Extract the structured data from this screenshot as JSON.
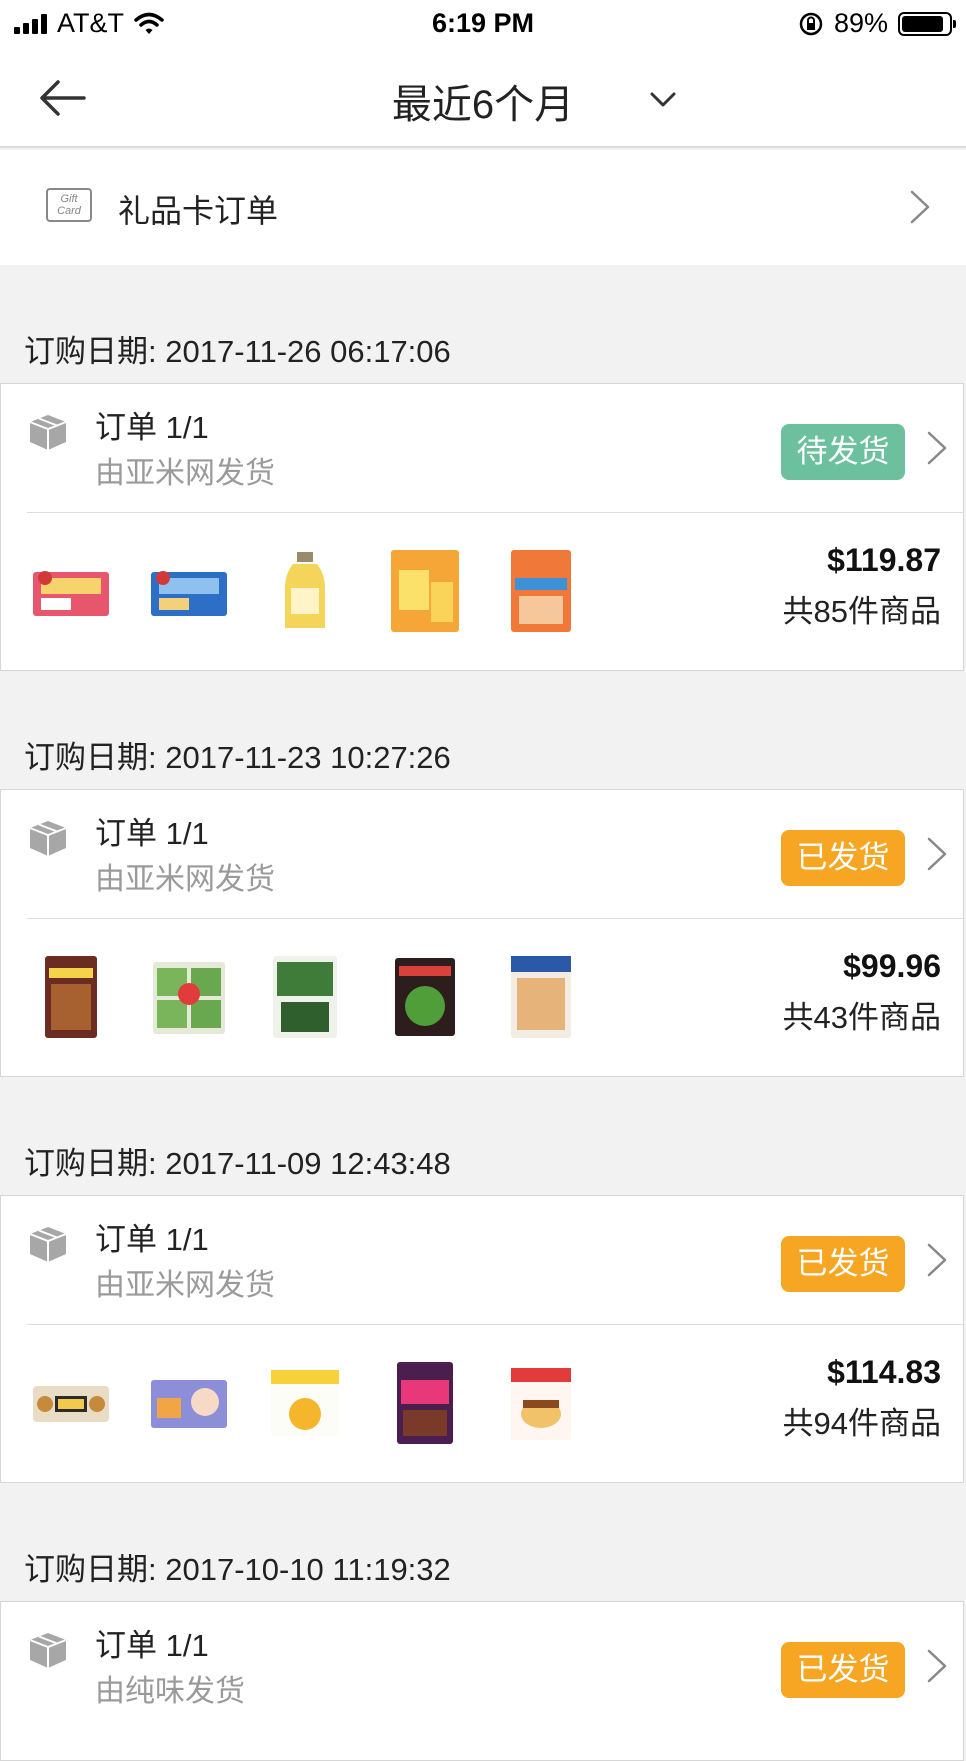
{
  "status_bar": {
    "carrier": "AT&T",
    "time": "6:19 PM",
    "battery": "89%",
    "battery_level": 0.89
  },
  "header": {
    "title": "最近6个月"
  },
  "gift_card": {
    "label": "礼品卡订单",
    "icon_text": "Gift Card"
  },
  "colors": {
    "pending": "#6cc09e",
    "shipped": "#f6a623"
  },
  "orders": [
    {
      "date": "订购日期: 2017-11-26 06:17:06",
      "order_no": "订单 1/1",
      "seller": "由亚米网发货",
      "status": "待发货",
      "price": "$119.87",
      "count": "共85件商品"
    },
    {
      "date": "订购日期: 2017-11-23 10:27:26",
      "order_no": "订单 1/1",
      "seller": "由亚米网发货",
      "status": "已发货",
      "price": "$99.96",
      "count": "共43件商品"
    },
    {
      "date": "订购日期: 2017-11-09 12:43:48",
      "order_no": "订单 1/1",
      "seller": "由亚米网发货",
      "status": "已发货",
      "price": "$114.83",
      "count": "共94件商品"
    },
    {
      "date": "订购日期: 2017-10-10 11:19:32",
      "order_no": "订单 1/1",
      "seller": "由纯味发货",
      "status": "已发货"
    }
  ]
}
